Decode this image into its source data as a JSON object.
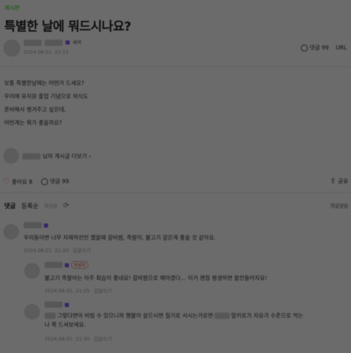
{
  "post": {
    "category": "게시판",
    "title": "특별한 날에 뭐드시나요?",
    "author_grade": "새싹",
    "date": "2024.06.01. 21:11",
    "comment_count_label": "댓글 99",
    "url_label": "URL",
    "body_lines": [
      "보통 특별한날에는 어떤거 드세요?",
      "우리애 유치원 졸업 기념으로 외식도",
      "준비해서 챙겨주고 싶은데,",
      "어떤게는 뭐가 좋을까요?"
    ],
    "profile_link": "님의 게시글 더보기 ›"
  },
  "actions": {
    "like_label": "좋아요 8",
    "comment_label": "댓글 99",
    "share_label": "공유"
  },
  "comments_header": {
    "title": "댓글",
    "sort_primary": "등록순",
    "sort_secondary": "최신순",
    "right_label": "댓글알림"
  },
  "comments": [
    {
      "text": "우리동이면 너무 자제하진인 했을때 갈비찜, 족발이, 불고기 갈은게 좋을 것 같아요.",
      "date": "2024.06.01. 21:20",
      "reply_label": "답글쓰기"
    },
    {
      "badge": "작성자",
      "text": "불고기 족발아는 아주 최습이 좋네요! 갈비찜으로 해야겠다… 이거 괜찮 평생하면 왈칸들어지요!",
      "date": "2024.06.01. 21:25",
      "reply_label": "답글쓰기"
    },
    {
      "text_line1": "그렇다면아 비빔 수 있으니까 행볼이 살으시면 질기로 서시는거로면",
      "text_line1b": "말키로가 자요가 수준으로 먹는",
      "text_line2": "나 쭉 드셔보세요.",
      "date": "2024.06.01. 21:30",
      "reply_label": "답글쓰기"
    }
  ]
}
